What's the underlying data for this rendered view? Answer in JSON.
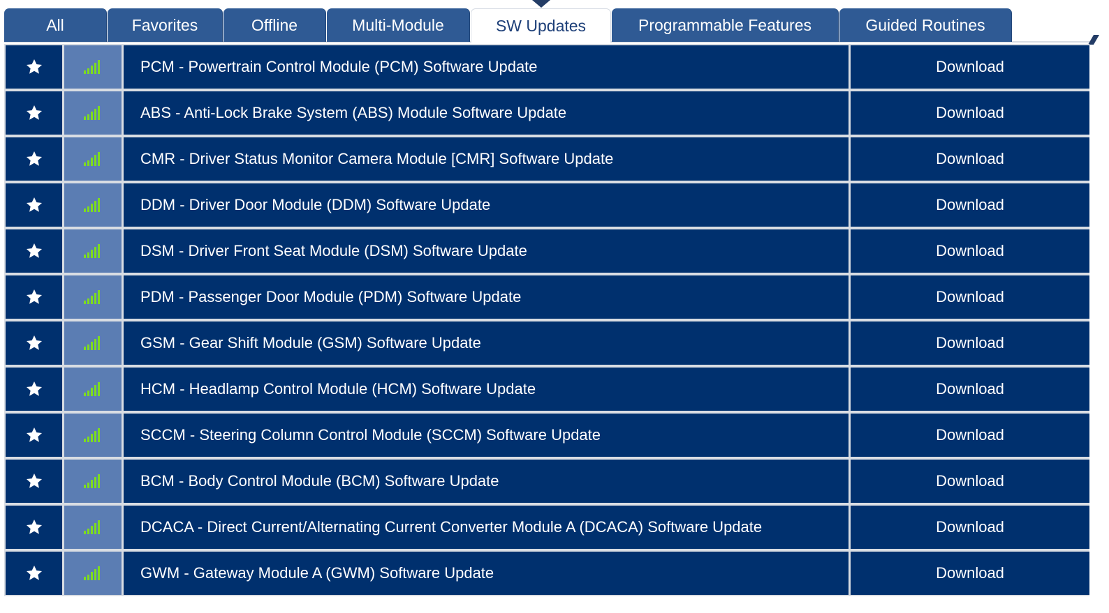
{
  "tabs": [
    {
      "label": "All",
      "active": false
    },
    {
      "label": "Favorites",
      "active": false
    },
    {
      "label": "Offline",
      "active": false
    },
    {
      "label": "Multi-Module",
      "active": false
    },
    {
      "label": "SW Updates",
      "active": true
    },
    {
      "label": "Programmable Features",
      "active": false
    },
    {
      "label": "Guided Routines",
      "active": false
    }
  ],
  "icons": {
    "favorite": "star-icon",
    "connectivity": "signal-strength-icon"
  },
  "colors": {
    "tab_bg": "#2f5a94",
    "row_bg": "#00306e",
    "signal_cell_bg": "#5b7db3",
    "signal_bars": "#7ddc1f",
    "active_tab_text": "#1d3f78"
  },
  "rows": [
    {
      "name": "PCM - Powertrain Control Module (PCM) Software Update",
      "action": "Download"
    },
    {
      "name": "ABS - Anti-Lock Brake System (ABS) Module Software Update",
      "action": "Download"
    },
    {
      "name": "CMR - Driver Status Monitor Camera Module [CMR] Software Update",
      "action": "Download"
    },
    {
      "name": "DDM - Driver Door Module (DDM) Software Update",
      "action": "Download"
    },
    {
      "name": "DSM - Driver Front Seat Module (DSM) Software Update",
      "action": "Download"
    },
    {
      "name": "PDM - Passenger Door Module (PDM) Software Update",
      "action": "Download"
    },
    {
      "name": "GSM - Gear Shift Module (GSM) Software Update",
      "action": "Download"
    },
    {
      "name": "HCM - Headlamp Control Module (HCM) Software Update",
      "action": "Download"
    },
    {
      "name": "SCCM - Steering Column Control Module (SCCM) Software Update",
      "action": "Download"
    },
    {
      "name": "BCM - Body Control Module (BCM) Software Update",
      "action": "Download"
    },
    {
      "name": "DCACA - Direct Current/Alternating Current Converter Module A (DCACA) Software Update",
      "action": "Download"
    },
    {
      "name": "GWM - Gateway Module A (GWM) Software Update",
      "action": "Download"
    }
  ]
}
